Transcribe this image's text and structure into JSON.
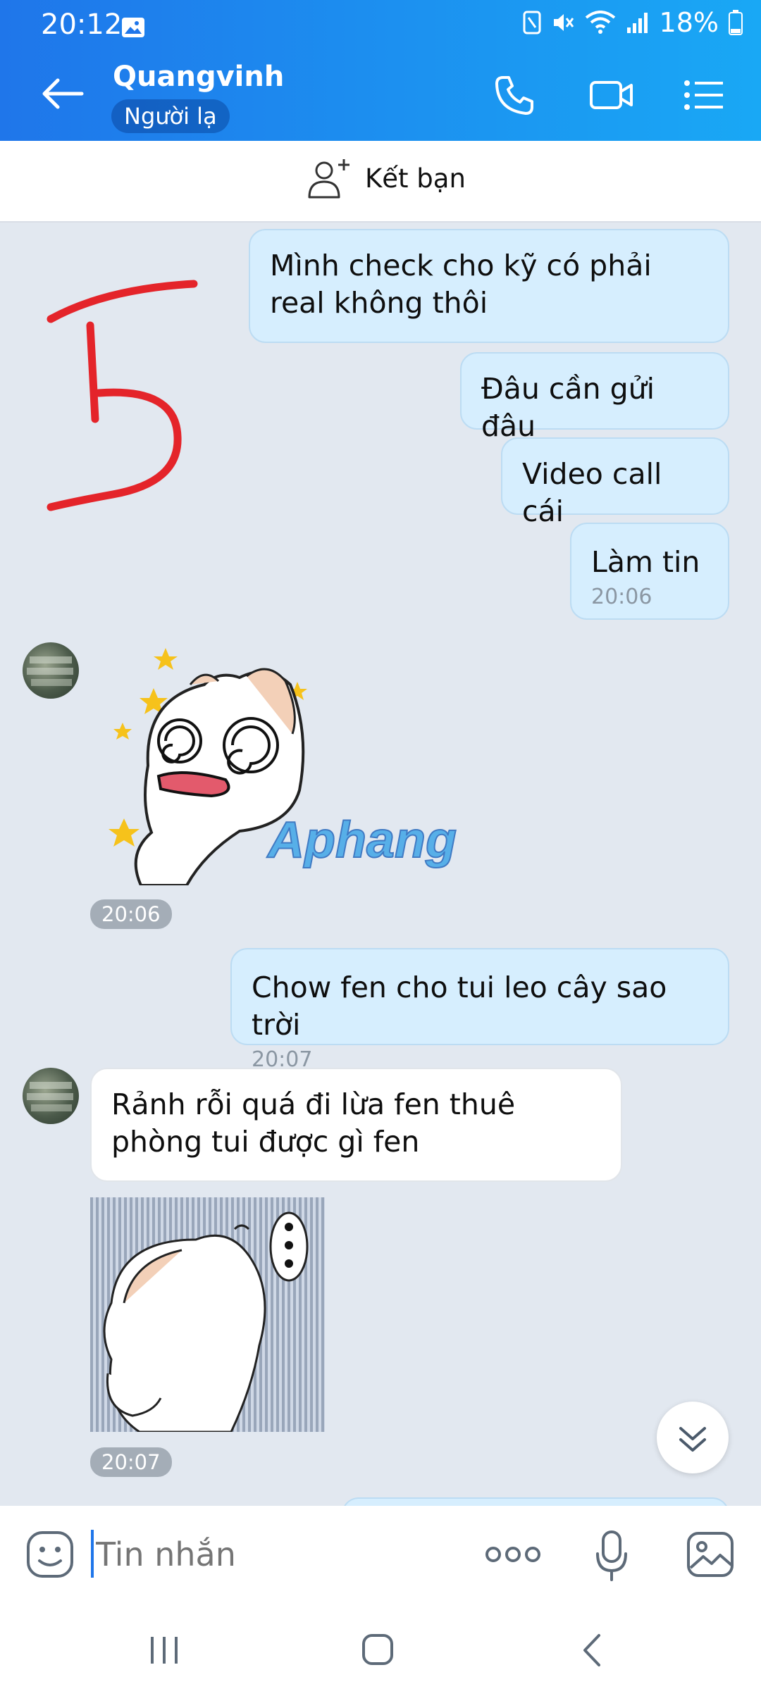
{
  "status_bar": {
    "time": "20:12",
    "battery": "18%"
  },
  "header": {
    "contact_name": "Quangvinh",
    "badge": "Người lạ"
  },
  "add_friend": {
    "label": "Kết bạn"
  },
  "messages": {
    "out1": "Mình check cho kỹ có phải real không thôi",
    "out2": "Đâu cần gửi đâu",
    "out3": "Video call cái",
    "out4": "Làm tin",
    "out4_time": "20:06",
    "sticker1_time": "20:06",
    "sticker1_watermark": "Aphang",
    "out5": "Chow fen cho tui leo cây sao trời",
    "out5_time": "20:07",
    "in1": "Rảnh rỗi quá đi lừa fen thuê phòng tui được gì fen",
    "sticker2_time": "20:07"
  },
  "input": {
    "placeholder": "Tin nhắn"
  },
  "annotation": {
    "mark": "5",
    "color": "#e4242a"
  },
  "colors": {
    "header_gradient_start": "#1f76ea",
    "header_gradient_end": "#19a8f5",
    "outgoing_bubble": "#d6eefe",
    "chat_background": "#e2e8f0"
  },
  "icons": [
    "back-arrow-icon",
    "phone-icon",
    "video-camera-icon",
    "list-menu-icon",
    "add-person-icon",
    "emoji-icon",
    "more-dots-icon",
    "microphone-icon",
    "image-gallery-icon",
    "chevron-double-down-icon"
  ]
}
